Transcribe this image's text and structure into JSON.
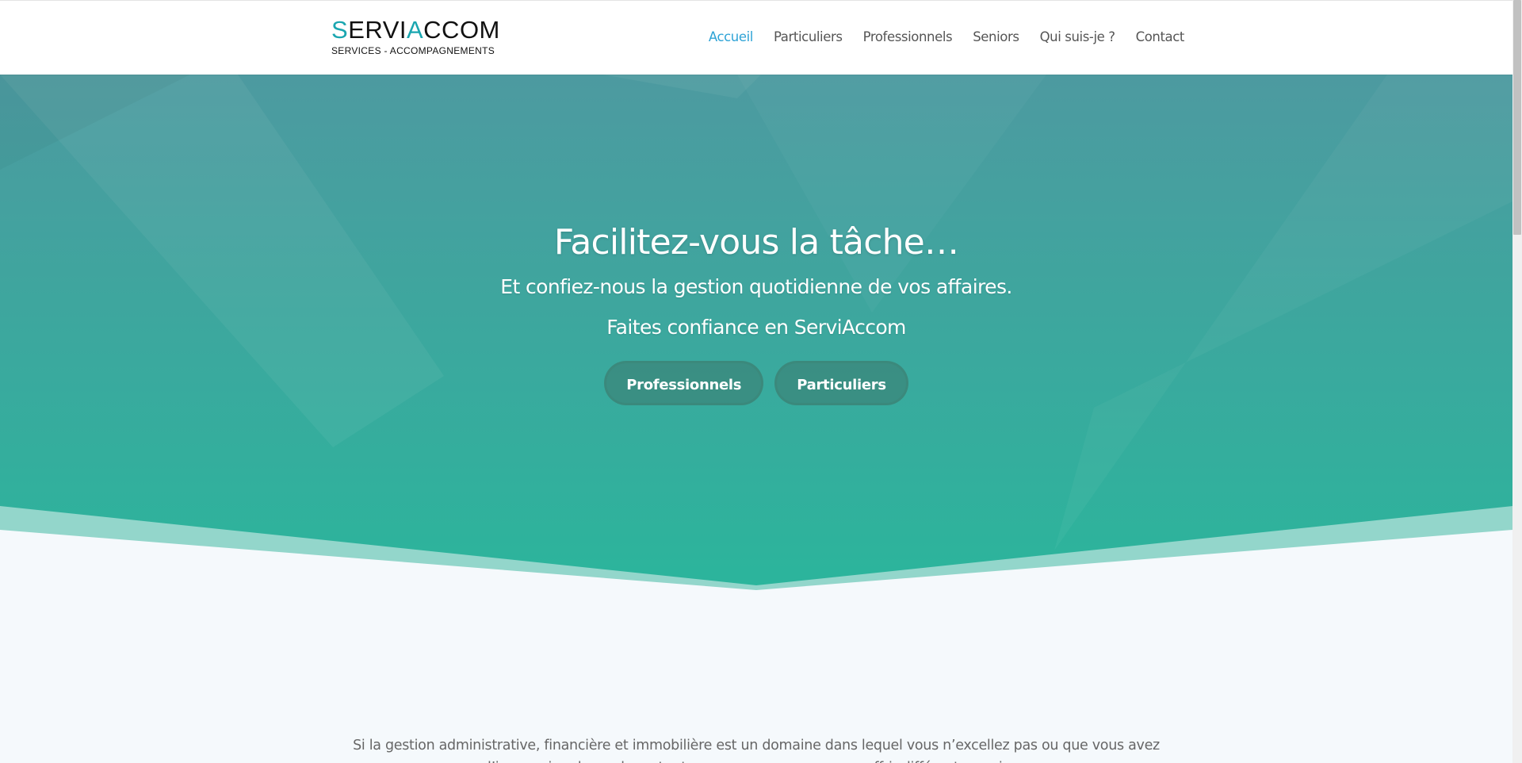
{
  "header": {
    "logo": {
      "title_parts": [
        "S",
        "ERVI",
        "A",
        "CCOM"
      ],
      "subtitle": "SERVICES - ACCOMPAGNEMENTS"
    },
    "nav": [
      {
        "label": "Accueil",
        "active": true
      },
      {
        "label": "Particuliers",
        "active": false
      },
      {
        "label": "Professionnels",
        "active": false
      },
      {
        "label": "Seniors",
        "active": false
      },
      {
        "label": "Qui suis-je ?",
        "active": false
      },
      {
        "label": "Contact",
        "active": false
      }
    ]
  },
  "hero": {
    "title": "Facilitez-vous la tâche…",
    "subtitle1": "Et confiez-nous la gestion quotidienne de vos affaires.",
    "subtitle2": "Faites confiance en ServiAccom",
    "buttons": [
      {
        "label": "Professionnels"
      },
      {
        "label": "Particuliers"
      }
    ]
  },
  "intro": {
    "line1": "Si la gestion administrative, financière et immobilière est un domaine dans lequel vous n’excellez pas ou que vous avez",
    "line2": "l’impression de perdre votre temps, nous pouvons vous offrir différents services"
  },
  "colors": {
    "accent": "#1aa6b0",
    "nav_active": "#2ea3d6",
    "hero_top": "#4d9aa0",
    "hero_bottom": "#2bb59c",
    "page_bg": "#f5f9fc"
  }
}
